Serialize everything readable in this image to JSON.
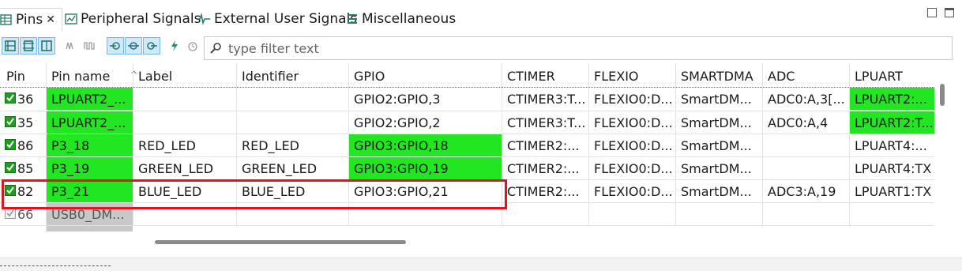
{
  "tabs": [
    {
      "label": "Pins",
      "icon": "table-icon",
      "active": true,
      "closable": true
    },
    {
      "label": "Peripheral Signals",
      "icon": "chart-icon"
    },
    {
      "label": "External User Signals",
      "icon": "signal-icon"
    },
    {
      "label": "Miscellaneous",
      "icon": "list-icon"
    }
  ],
  "toolbar": {
    "filter_placeholder": "type filter text"
  },
  "columns": [
    "Pin",
    "Pin name",
    "Label",
    "Identifier",
    "GPIO",
    "CTIMER",
    "FLEXIO",
    "SMARTDMA",
    "ADC",
    "LPUART"
  ],
  "rows": [
    {
      "pin": "36",
      "pin_name": "LPUART2_...",
      "label": "",
      "identifier": "",
      "gpio": "GPIO2:GPIO,3",
      "ctimer": "CTIMER3:T...",
      "flexio": "FLEXIO0:D...",
      "smartdma": "SmartDM...",
      "adc": "ADC0:A,3[...",
      "lpuart": "LPUART2:..."
    },
    {
      "pin": "35",
      "pin_name": "LPUART2_...",
      "label": "",
      "identifier": "",
      "gpio": "GPIO2:GPIO,2",
      "ctimer": "CTIMER3:T...",
      "flexio": "FLEXIO0:D...",
      "smartdma": "SmartDM...",
      "adc": "ADC0:A,4",
      "lpuart": "LPUART2:T..."
    },
    {
      "pin": "86",
      "pin_name": "P3_18",
      "label": "RED_LED",
      "identifier": "RED_LED",
      "gpio": "GPIO3:GPIO,18",
      "ctimer": "CTIMER2:...",
      "flexio": "FLEXIO0:D...",
      "smartdma": "SmartDM...",
      "adc": "",
      "lpuart": "LPUART4:..."
    },
    {
      "pin": "85",
      "pin_name": "P3_19",
      "label": "GREEN_LED",
      "identifier": "GREEN_LED",
      "gpio": "GPIO3:GPIO,19",
      "ctimer": "CTIMER2:...",
      "flexio": "FLEXIO0:D...",
      "smartdma": "SmartDM...",
      "adc": "",
      "lpuart": "LPUART4:TX"
    },
    {
      "pin": "82",
      "pin_name": "P3_21",
      "label": "BLUE_LED",
      "identifier": "BLUE_LED",
      "gpio": "GPIO3:GPIO,21",
      "ctimer": "CTIMER2:...",
      "flexio": "FLEXIO0:D...",
      "smartdma": "SmartDM...",
      "adc": "ADC3:A,19",
      "lpuart": "LPUART1:TX"
    },
    {
      "pin": "66",
      "pin_name": "USB0_DM...",
      "label": "",
      "identifier": "",
      "gpio": "",
      "ctimer": "",
      "flexio": "",
      "smartdma": "",
      "adc": "",
      "lpuart": ""
    }
  ],
  "colors": {
    "routed_green": "#22e622",
    "disabled_gray": "#c8c8c8",
    "highlight_red": "#e0141e",
    "selected_button": "#cfe8fb"
  }
}
